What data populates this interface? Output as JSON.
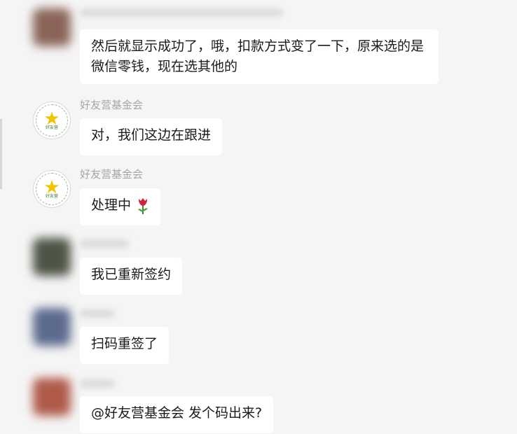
{
  "messages": [
    {
      "sender": "",
      "text": "然后就显示成功了，哦，扣款方式变了一下，原来选的是微信零钱，现在选其他的",
      "avatar_color": "#8a6458"
    },
    {
      "sender": "好友营基金会",
      "text": "对，我们这边在跟进",
      "avatar_color": "#ffffff"
    },
    {
      "sender": "好友营基金会",
      "text": "处理中",
      "emoji": "tulip-icon",
      "avatar_color": "#ffffff"
    },
    {
      "sender": "",
      "text": "我已重新签约",
      "avatar_color": "#4e5446"
    },
    {
      "sender": "",
      "text": "扫码重签了",
      "avatar_color": "#5c6a8e"
    },
    {
      "sender": "",
      "text": "@好友营基金会 发个码出来?",
      "avatar_color": "#b05a4a"
    }
  ],
  "colors": {
    "background": "#f5f5f5",
    "bubble": "#ffffff",
    "text": "#1a1a1a",
    "sender_name": "#a7a7a7"
  }
}
